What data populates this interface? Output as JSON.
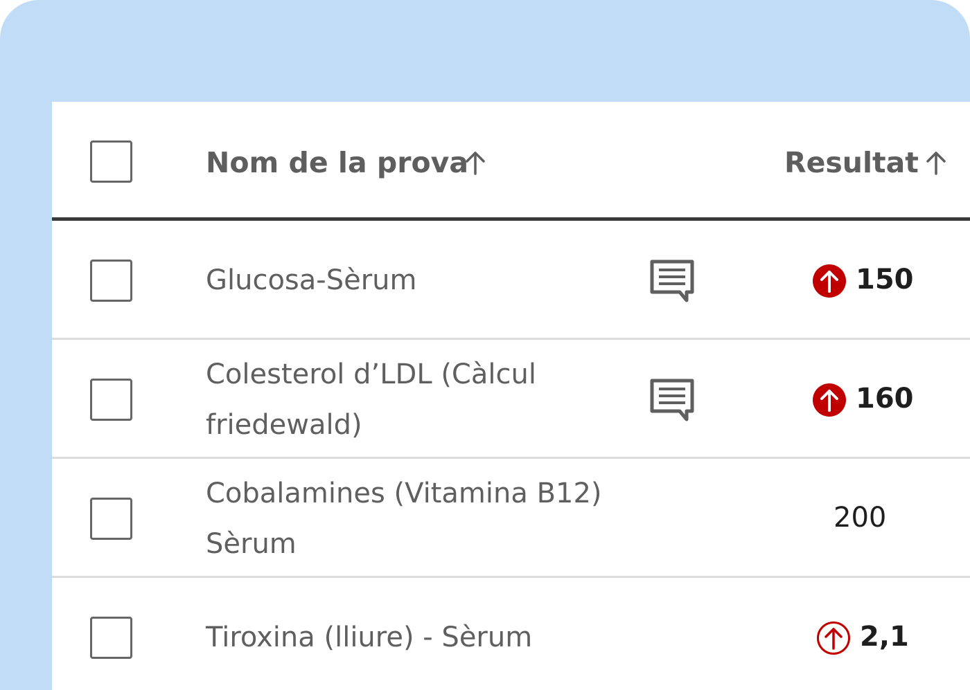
{
  "table": {
    "header": {
      "name_label": "Nom de la prova",
      "result_label": "Resultat"
    },
    "rows": [
      {
        "name": "Glucosa-Sèrum",
        "has_comment": true,
        "flag": "high",
        "value": "150"
      },
      {
        "name": "Colesterol d’LDL (Càlcul friedewald)",
        "has_comment": true,
        "flag": "high",
        "value": "160"
      },
      {
        "name": "Cobalamines (Vitamina B12) Sèrum",
        "has_comment": false,
        "flag": "none",
        "value": "200"
      },
      {
        "name": "Tiroxina (lliure) - Sèrum",
        "has_comment": false,
        "flag": "high-outline",
        "value": "2,1"
      }
    ]
  },
  "icons": {
    "sort": "arrow-up-icon",
    "comment": "comment-icon",
    "flag_high": "arrow-up-circle-filled-icon",
    "flag_high_outline": "arrow-up-circle-outline-icon"
  },
  "colors": {
    "background_frame": "#c0dcf7",
    "flag_red": "#c00000",
    "header_text": "#5e5e5e",
    "divider_dark": "#3a3a3a"
  }
}
